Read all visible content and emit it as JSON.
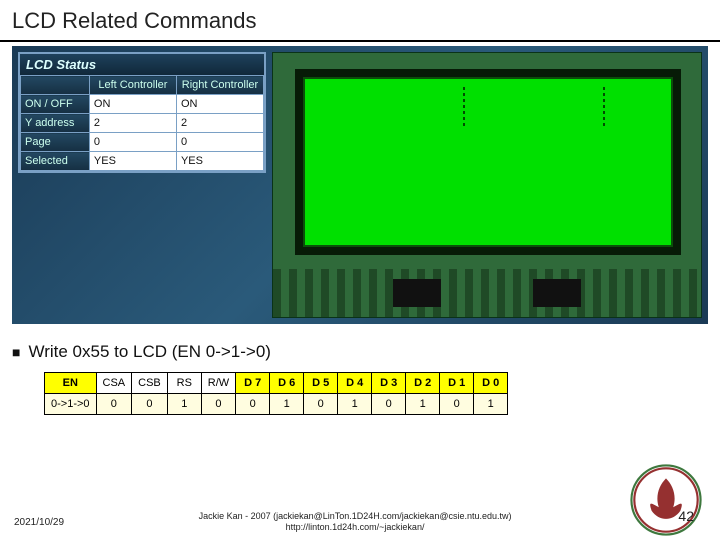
{
  "title": "LCD Related Commands",
  "status": {
    "heading": "LCD Status",
    "col1": "Left Controller",
    "col2": "Right Controller",
    "rows": [
      {
        "label": "ON / OFF",
        "l": "ON",
        "r": "ON"
      },
      {
        "label": "Y address",
        "l": "2",
        "r": "2"
      },
      {
        "label": "Page",
        "l": "0",
        "r": "0"
      },
      {
        "label": "Selected",
        "l": "YES",
        "r": "YES"
      }
    ]
  },
  "bullet": "Write 0x55 to LCD (EN 0->1->0)",
  "cmd_table": {
    "headers": [
      "EN",
      "CSA",
      "CSB",
      "RS",
      "R/W",
      "D 7",
      "D 6",
      "D 5",
      "D 4",
      "D 3",
      "D 2",
      "D 1",
      "D 0"
    ],
    "values": [
      "0->1->0",
      "0",
      "0",
      "1",
      "0",
      "0",
      "1",
      "0",
      "1",
      "0",
      "1",
      "0",
      "1"
    ]
  },
  "footer": {
    "date": "2021/10/29",
    "credit_line1": "Jackie Kan - 2007 (jackiekan@LinTon.1D24H.com/jackiekan@csie.ntu.edu.tw)",
    "credit_line2": "http://linton.1d24h.com/~jackiekan/",
    "page": "42"
  }
}
